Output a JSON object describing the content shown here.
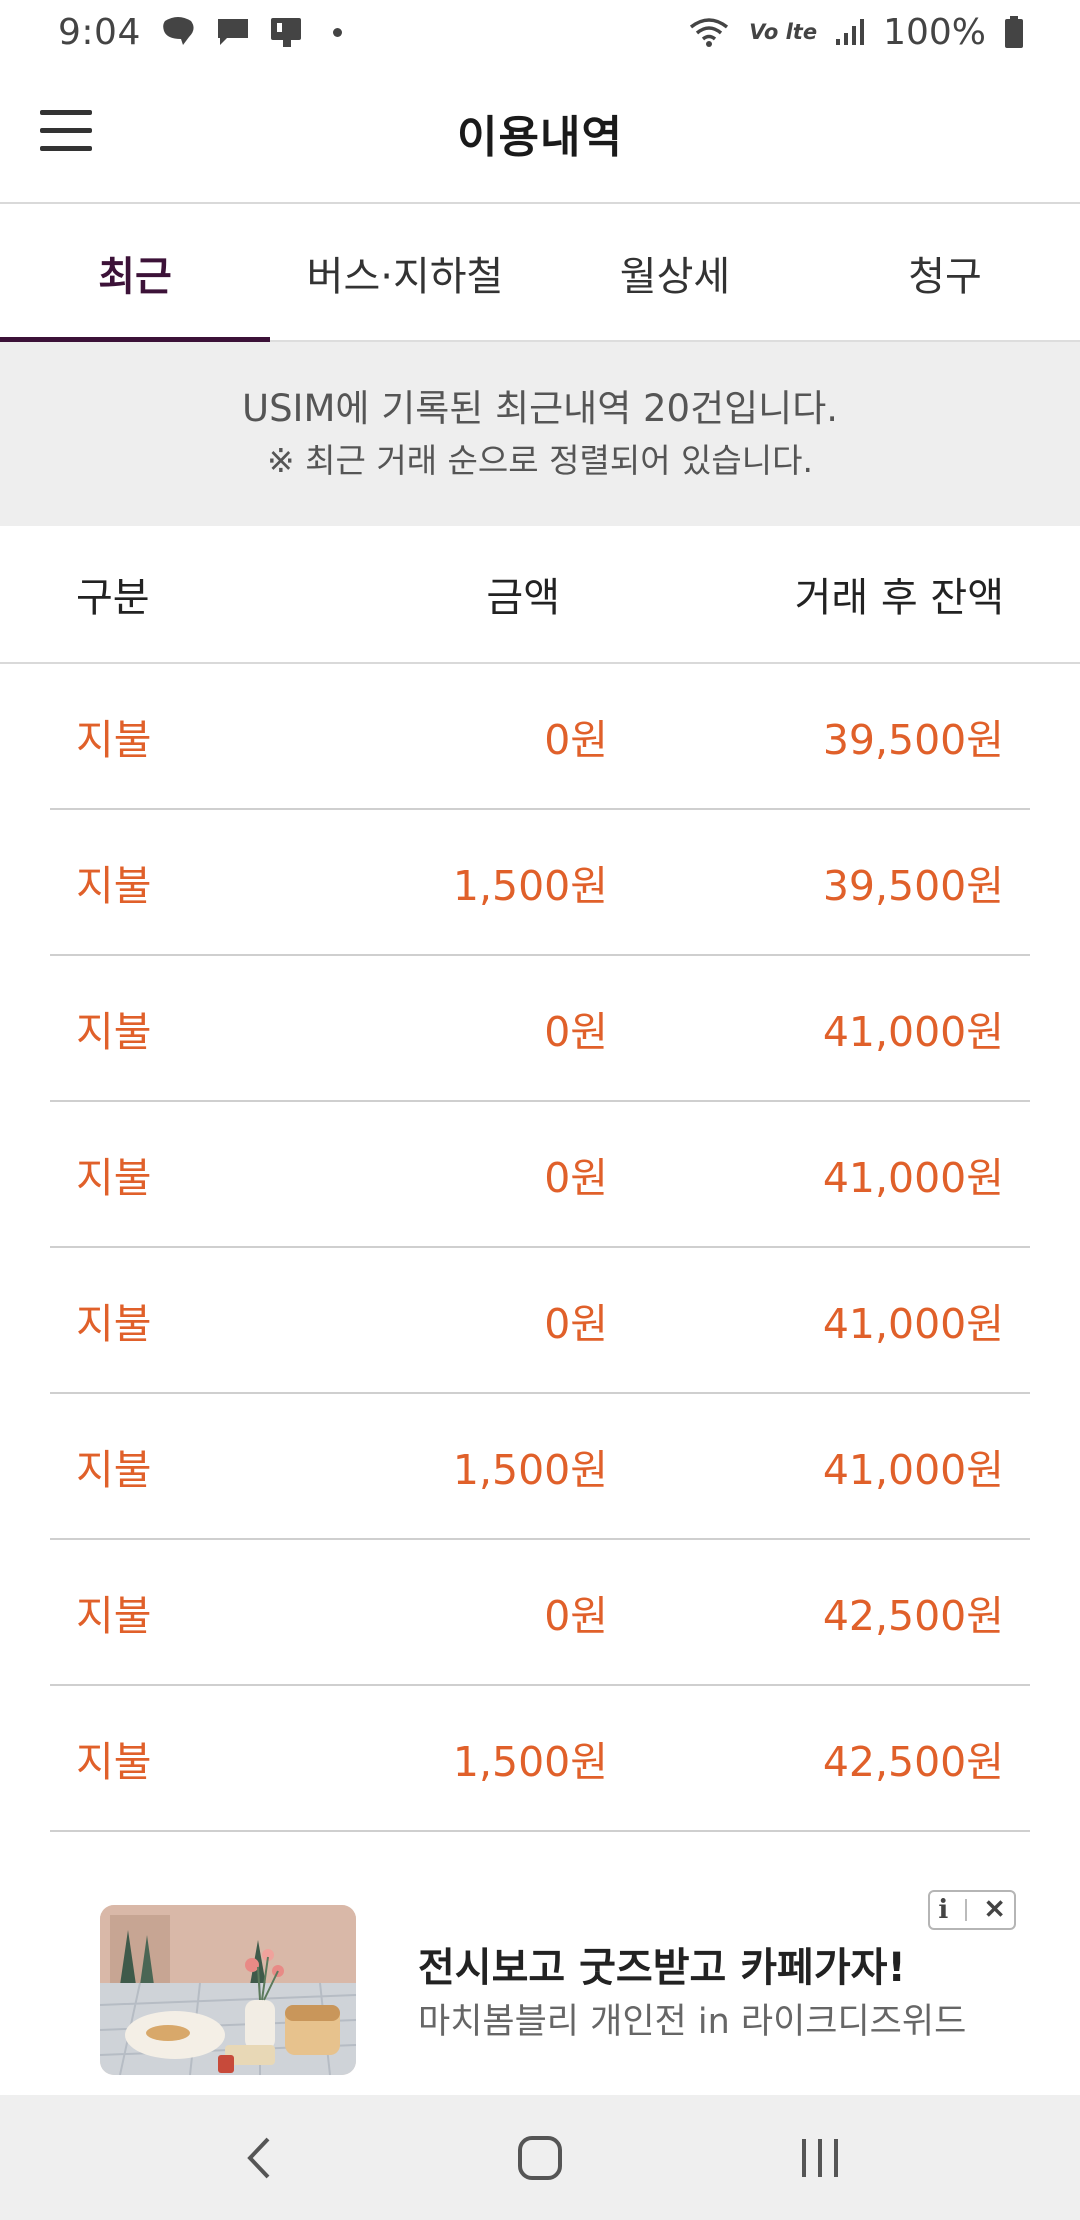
{
  "status_bar": {
    "time": "9:04",
    "volte": "Vo lte",
    "battery": "100%"
  },
  "header": {
    "title": "이용내역"
  },
  "tabs": [
    {
      "label": "최근",
      "active": true
    },
    {
      "label": "버스·지하철",
      "active": false
    },
    {
      "label": "월상세",
      "active": false
    },
    {
      "label": "청구",
      "active": false
    }
  ],
  "notice": {
    "line1": "USIM에 기록된 최근내역 20건입니다.",
    "line2": "※ 최근 거래 순으로 정렬되어 있습니다."
  },
  "table": {
    "headers": {
      "type": "구분",
      "amount": "금액",
      "balance": "거래 후 잔액"
    },
    "rows": [
      {
        "type": "지불",
        "amount": "0원",
        "balance": "39,500원"
      },
      {
        "type": "지불",
        "amount": "1,500원",
        "balance": "39,500원"
      },
      {
        "type": "지불",
        "amount": "0원",
        "balance": "41,000원"
      },
      {
        "type": "지불",
        "amount": "0원",
        "balance": "41,000원"
      },
      {
        "type": "지불",
        "amount": "0원",
        "balance": "41,000원"
      },
      {
        "type": "지불",
        "amount": "1,500원",
        "balance": "41,000원"
      },
      {
        "type": "지불",
        "amount": "0원",
        "balance": "42,500원"
      },
      {
        "type": "지불",
        "amount": "1,500원",
        "balance": "42,500원"
      }
    ]
  },
  "ad": {
    "title": "전시보고 굿즈받고 카페가자!",
    "subtitle": "마치봄블리 개인전 in 라이크디즈위드",
    "badge_info": "i",
    "badge_close": "✕"
  },
  "colors": {
    "accent": "#3c1238",
    "row_text": "#e0602a",
    "notice_bg": "#eeeeee",
    "navbar_bg": "#efefef"
  }
}
